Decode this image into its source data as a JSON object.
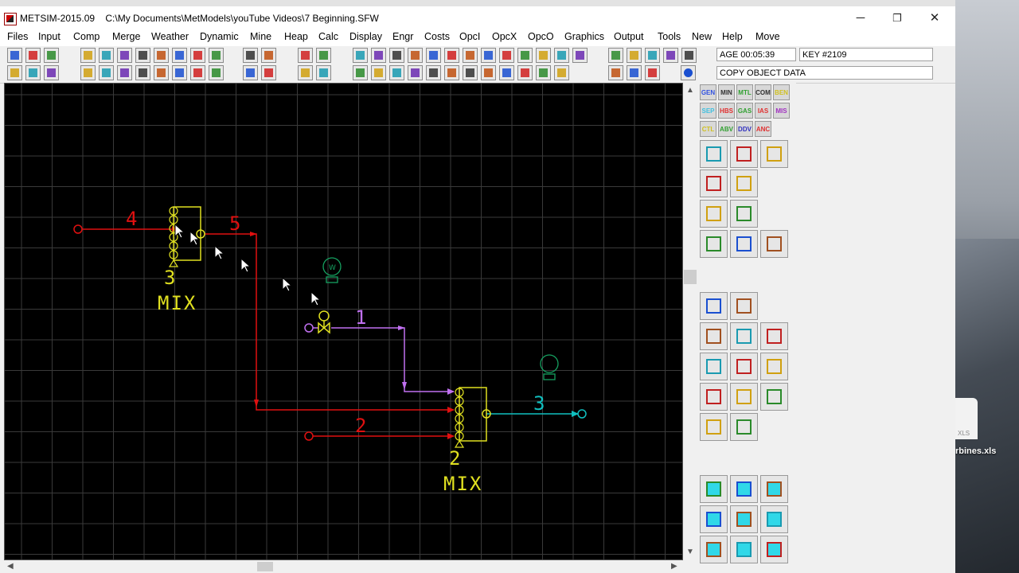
{
  "window": {
    "title": "METSIM-2015.09",
    "path": "C:\\My Documents\\MetModels\\youTube Videos\\7 Beginning.SFW",
    "minimize": "─",
    "restore": "❐",
    "close": "✕"
  },
  "menu": [
    "Files",
    "Input",
    "Comp",
    "Merge",
    "Weather",
    "Dynamic",
    "Mine",
    "Heap",
    "Calc",
    "Display",
    "Engr",
    "Costs",
    "OpcI",
    "OpcX",
    "OpcO",
    "Graphics",
    "Output",
    "Tools",
    "New",
    "Help",
    "Move"
  ],
  "status": {
    "age": "AGE 00:05:39",
    "key": "KEY #2109",
    "message": "COPY OBJECT DATA"
  },
  "palette_tags": [
    "GEN",
    "MIN",
    "MTL",
    "COM",
    "BEN",
    "SEP",
    "HBS",
    "GAS",
    "IAS",
    "MIS",
    "CTL",
    "ABV",
    "DDV",
    "ANC"
  ],
  "flowsheet": {
    "streams": [
      {
        "label": "4",
        "color": "#e01010"
      },
      {
        "label": "5",
        "color": "#e01010"
      },
      {
        "label": "1",
        "color": "#c070f0"
      },
      {
        "label": "2",
        "color": "#e01010"
      },
      {
        "label": "3",
        "color": "#10c0c0"
      }
    ],
    "units": [
      {
        "number": "3",
        "type": "MIX",
        "color": "#e0e020"
      },
      {
        "number": "2",
        "type": "MIX",
        "color": "#e0e020"
      }
    ]
  },
  "desktop": {
    "file_ext": "XLS",
    "file_name": "rbines.xls"
  }
}
